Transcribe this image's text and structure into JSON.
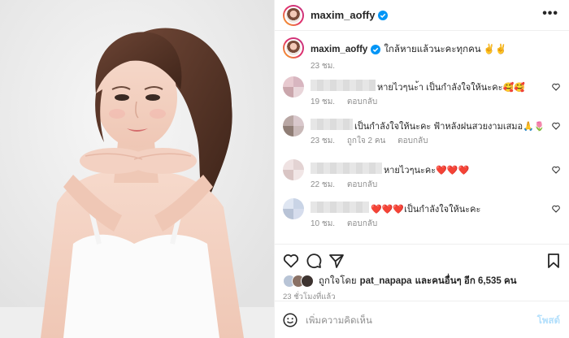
{
  "header": {
    "username": "maxim_aoffy",
    "more_label": "•••"
  },
  "caption": {
    "username": "maxim_aoffy",
    "text": "ใกล้หายแล้วนะคะทุกคน ✌️✌️",
    "time": "23 ชม."
  },
  "comments": [
    {
      "text": "หายไวๆนะ้า เป็นกำลังใจให้นะคะ🥰🥰",
      "time": "19 ชม.",
      "likes": "",
      "reply": "ตอบกลับ"
    },
    {
      "text": "เป็นกำลังใจให้นะคะ ฟ้าหลังฝนสวยงามเสมอ🙏🌷",
      "time": "23 ชม.",
      "likes": "ถูกใจ 2 คน",
      "reply": "ตอบกลับ"
    },
    {
      "text": "หายไวๆนะคะ❤️❤️❤️",
      "time": "22 ชม.",
      "likes": "",
      "reply": "ตอบกลับ"
    },
    {
      "text": "❤️❤️❤️เป็นกำลังใจให้นะคะ",
      "time": "10 ชม.",
      "likes": "",
      "reply": "ตอบกลับ"
    }
  ],
  "likes": {
    "prefix": "ถูกใจโดย",
    "user": "pat_napapa",
    "suffix": "และคนอื่นๆ อีก 6,535 คน"
  },
  "post_time": "23 ชั่วโมงที่แล้ว",
  "add_comment": {
    "placeholder": "เพิ่มความคิดเห็น",
    "post_label": "โพสต์"
  },
  "icons": {
    "verified": "verified-badge-icon",
    "like": "heart-icon",
    "comment": "comment-icon",
    "share": "send-icon",
    "save": "bookmark-icon",
    "emoji": "emoji-icon"
  },
  "colors": {
    "verified": "#0095f6",
    "muted": "#8e8e8e",
    "post_disabled": "#b2dffc"
  }
}
